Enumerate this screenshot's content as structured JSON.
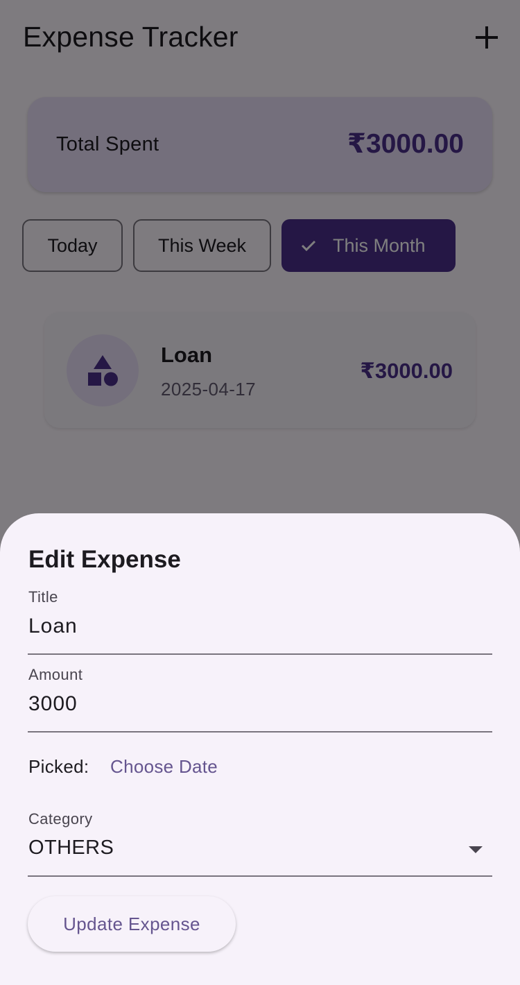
{
  "app_bar": {
    "title": "Expense Tracker",
    "add_icon": "plus-icon"
  },
  "summary": {
    "label": "Total Spent",
    "amount": "₹3000.00"
  },
  "filters": {
    "today": "Today",
    "week": "This Week",
    "month": "This Month",
    "selected": "This Month"
  },
  "expenses": [
    {
      "title": "Loan",
      "date": "2025-04-17",
      "amount": "₹3000.00",
      "category_icon": "shapes-icon"
    }
  ],
  "edit_sheet": {
    "heading": "Edit Expense",
    "title_label": "Title",
    "title_value": "Loan",
    "amount_label": "Amount",
    "amount_value": "3000",
    "picked_label": "Picked:",
    "choose_date": "Choose Date",
    "category_label": "Category",
    "category_value": "OTHERS",
    "submit": "Update Expense"
  },
  "colors": {
    "primary": "#4a2f8a",
    "primary_container": "#e8def8",
    "surface": "#fdf7ff",
    "sheet_surface": "#f7f2fa",
    "link": "#65558f"
  }
}
